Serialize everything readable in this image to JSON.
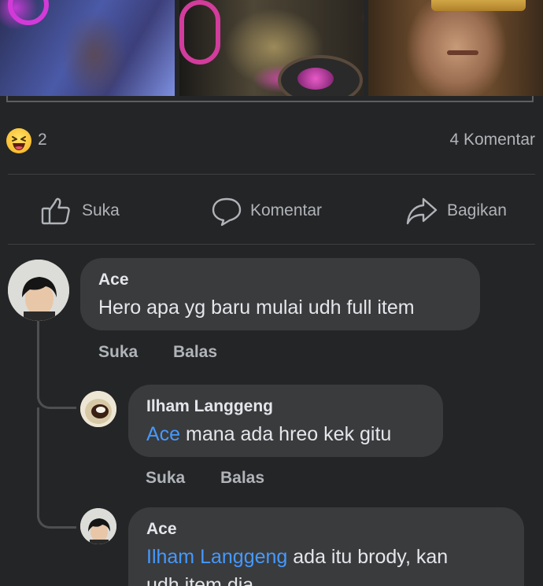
{
  "post": {
    "images": [
      {
        "icon": "hero-portrait-purple"
      },
      {
        "icon": "hero-gasmask-gold"
      },
      {
        "icon": "hero-portrait-gold"
      }
    ],
    "reaction_count": "2",
    "comment_count": "4 Komentar"
  },
  "actions": {
    "like_label": "Suka",
    "comment_label": "Komentar",
    "share_label": "Bagikan"
  },
  "comments": [
    {
      "author": "Ace",
      "mention": "",
      "text": "Hero apa yg baru mulai udh full item",
      "like_label": "Suka",
      "reply_label": "Balas"
    },
    {
      "author": "Ilham Langgeng",
      "mention": "Ace",
      "text": " mana ada hreo kek gitu",
      "like_label": "Suka",
      "reply_label": "Balas"
    },
    {
      "author": "Ace",
      "mention": "Ilham Langgeng",
      "text": " ada itu brody, kan",
      "text_line2": "udh item dia"
    }
  ],
  "colors": {
    "background": "#242526",
    "bubble": "#3a3b3c",
    "mention": "#4599ff",
    "muted_text": "#b0b3b8",
    "primary_text": "#e4e6eb"
  }
}
